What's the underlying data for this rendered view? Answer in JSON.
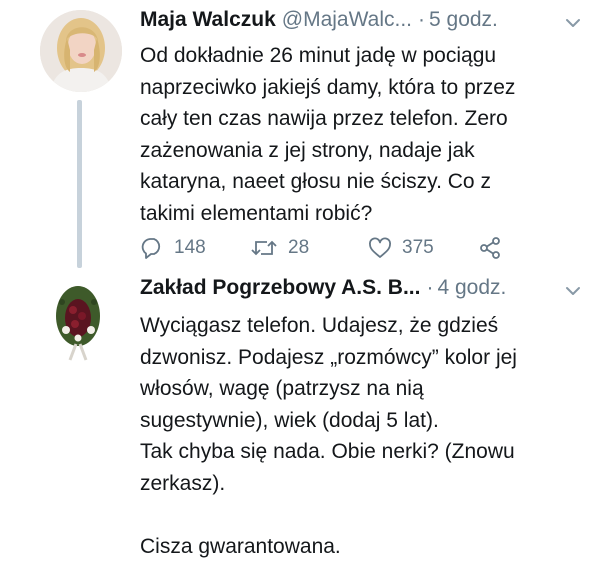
{
  "tweets": [
    {
      "author_name": "Maja Walczuk",
      "handle": "@MajaWalc...",
      "separator": "·",
      "time": "5 godz.",
      "text_lines": [
        "Od dokładnie 26 minut jadę w pociągu",
        "naprzeciwko jakiejś damy, która to przez",
        "cały ten czas nawija przez telefon. Zero",
        "zażenowania z jej strony, nadaje jak",
        "kataryna, naeet głosu nie ściszy. Co z",
        "takimi elementami robić?"
      ],
      "actions": {
        "replies": "148",
        "retweets": "28",
        "likes": "375"
      }
    },
    {
      "author_name": "Zakład Pogrzebowy A.S. B...",
      "separator": "·",
      "time": "4 godz.",
      "text_lines": [
        "Wyciągasz telefon. Udajesz, że gdzieś",
        "dzwonisz. Podajesz „rozmówcy” kolor jej",
        "włosów, wagę (patrzysz na nią",
        "sugestywnie), wiek (dodaj 5 lat).",
        "Tak chyba się nada. Obie nerki? (Znowu",
        "zerkasz)."
      ],
      "closing_line": "Cisza gwarantowana."
    }
  ],
  "icons": {
    "reply": "reply-icon",
    "retweet": "retweet-icon",
    "like": "heart-icon",
    "share": "share-icon",
    "menu": "chevron-down-icon"
  },
  "colors": {
    "text": "#14171a",
    "secondary": "#657786",
    "thread_line": "#c7d2db"
  }
}
